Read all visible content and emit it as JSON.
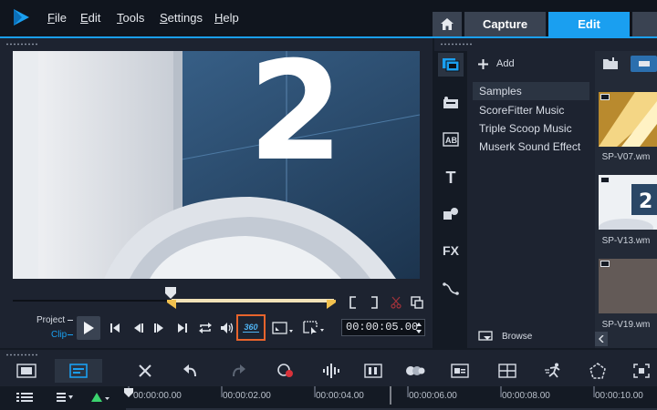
{
  "menu": {
    "items": [
      {
        "label": "File",
        "key": "F"
      },
      {
        "label": "Edit",
        "key": "E"
      },
      {
        "label": "Tools",
        "key": "T"
      },
      {
        "label": "Settings",
        "key": "S"
      },
      {
        "label": "Help",
        "key": "H"
      }
    ]
  },
  "tabs": {
    "capture": "Capture",
    "edit": "Edit"
  },
  "player": {
    "preview_number": "2",
    "project_label": "Project",
    "clip_label": "Clip",
    "timecode": "00:00:05.00",
    "vr_label": "360"
  },
  "library": {
    "add_label": "Add",
    "items": [
      "Samples",
      "ScoreFitter Music",
      "Triple Scoop Music",
      "Muserk Sound Effect"
    ],
    "selected_index": 0,
    "browse_label": "Browse",
    "fx_label": "FX",
    "title_icon": "T",
    "thumbs": [
      "SP-V07.wm",
      "SP-V13.wm",
      "SP-V19.wm"
    ]
  },
  "timeline": {
    "ticks": [
      "00:00:00.00",
      "00:00:02.00",
      "00:00:04.00",
      "00:00:06.00",
      "00:00:08.00",
      "00:00:10.00"
    ]
  },
  "colors": {
    "accent": "#1a9ff0",
    "highlight_orange": "#e8642c",
    "marker_yellow": "#f2c14e"
  }
}
